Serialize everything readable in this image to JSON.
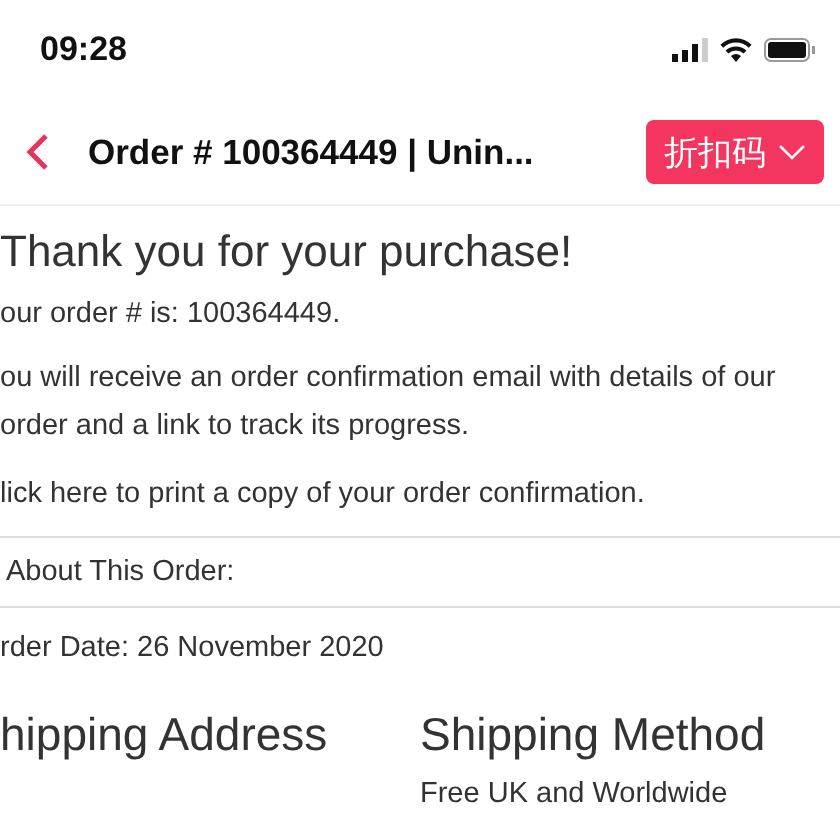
{
  "status_bar": {
    "time": "09:28"
  },
  "nav": {
    "title": "Order # 100364449 | Unin...",
    "coupon_button": "折扣码"
  },
  "heading": "Thank you for your purchase!",
  "order_number_line": "our order # is: 100364449.",
  "confirmation_text": "ou will receive an order confirmation email with details of our order and a link to track its progress.",
  "print_link": "lick here to print a copy of your order confirmation.",
  "about_section": "About This Order:",
  "order_date": "rder Date: 26 November 2020",
  "columns": [
    {
      "title": "hipping Address"
    },
    {
      "title": "Shipping Method",
      "text": "Free UK and Worldwide"
    }
  ]
}
